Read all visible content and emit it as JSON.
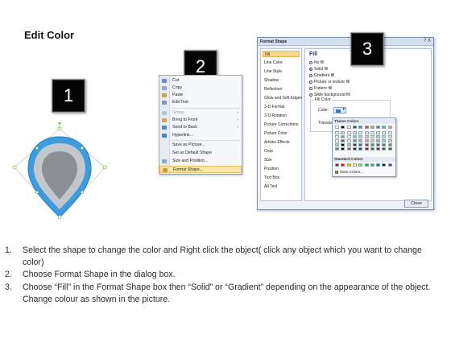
{
  "title": "Edit Color",
  "badges": [
    "1",
    "2",
    "3"
  ],
  "context_menu": {
    "items": [
      {
        "label": "Cut",
        "icon": "scissors-icon",
        "disabled": false
      },
      {
        "label": "Copy",
        "icon": "copy-icon",
        "disabled": false
      },
      {
        "label": "Paste",
        "icon": "paste-icon",
        "disabled": false
      },
      {
        "label": "Edit Text",
        "icon": "text-icon",
        "disabled": false
      },
      {
        "label": "Group",
        "icon": "group-icon",
        "disabled": true,
        "submenu": true
      },
      {
        "label": "Bring to Front",
        "icon": "bring-front-icon",
        "disabled": false,
        "submenu": true
      },
      {
        "label": "Send to Back",
        "icon": "send-back-icon",
        "disabled": false,
        "submenu": true
      },
      {
        "label": "Hyperlink...",
        "icon": "hyperlink-icon",
        "disabled": false
      },
      {
        "label": "Save as Picture...",
        "icon": "picture-icon",
        "disabled": false
      },
      {
        "label": "Set as Default Shape",
        "icon": "default-shape-icon",
        "disabled": false
      },
      {
        "label": "Size and Position...",
        "icon": "size-icon",
        "disabled": false
      },
      {
        "label": "Format Shape...",
        "icon": "format-shape-icon",
        "disabled": false,
        "highlighted": true
      }
    ]
  },
  "dialog": {
    "title": "Format Shape",
    "title_controls": "? X",
    "nav": [
      "Fill",
      "Line Color",
      "Line Style",
      "Shadow",
      "Reflection",
      "Glow and Soft Edges",
      "3-D Format",
      "3-D Rotation",
      "Picture Corrections",
      "Picture Color",
      "Artistic Effects",
      "Crop",
      "Size",
      "Position",
      "Text Box",
      "Alt Text"
    ],
    "selected_nav": "Fill",
    "pane_title": "Fill",
    "fill_options": [
      {
        "label": "No fill",
        "selected": false
      },
      {
        "label": "Solid fill",
        "selected": true
      },
      {
        "label": "Gradient fill",
        "selected": false
      },
      {
        "label": "Picture or texture fill",
        "selected": false
      },
      {
        "label": "Pattern fill",
        "selected": false
      },
      {
        "label": "Slide background fill",
        "selected": false
      }
    ],
    "fill_color_group": "Fill Color",
    "color_label": "Color:",
    "transparency_label": "Transpa",
    "close_button": "Close"
  },
  "palette": {
    "theme_label": "Theme Colors",
    "standard_label": "Standard Colors",
    "more_label": "More Colors...",
    "theme_top": [
      "#ffffff",
      "#000000",
      "#eeece1",
      "#1f497d",
      "#4f81bd",
      "#c0504d",
      "#9bbb59",
      "#8064a2",
      "#4bacc6",
      "#f79646"
    ],
    "standard": [
      "#c00000",
      "#ff0000",
      "#ffc000",
      "#ffff00",
      "#92d050",
      "#00b050",
      "#00b0f0",
      "#0070c0",
      "#002060",
      "#7030a0"
    ]
  },
  "shape": {
    "outer_color": "#3d9be0",
    "inner_color": "#c2c7cd",
    "core_color": "#8c8f93",
    "handle_color": "#6fc04f"
  },
  "steps": [
    {
      "num": "1.",
      "text": "Select the shape to change the color and Right click the object( click any object which you want to change color)"
    },
    {
      "num": "2.",
      "text": "Choose Format Shape in the dialog box."
    },
    {
      "num": "3.",
      "text": "Choose “Fill” in the Format Shape box then “Solid” or “Gradient” depending on the appearance of the object. Change colour as shown in the picture."
    }
  ]
}
